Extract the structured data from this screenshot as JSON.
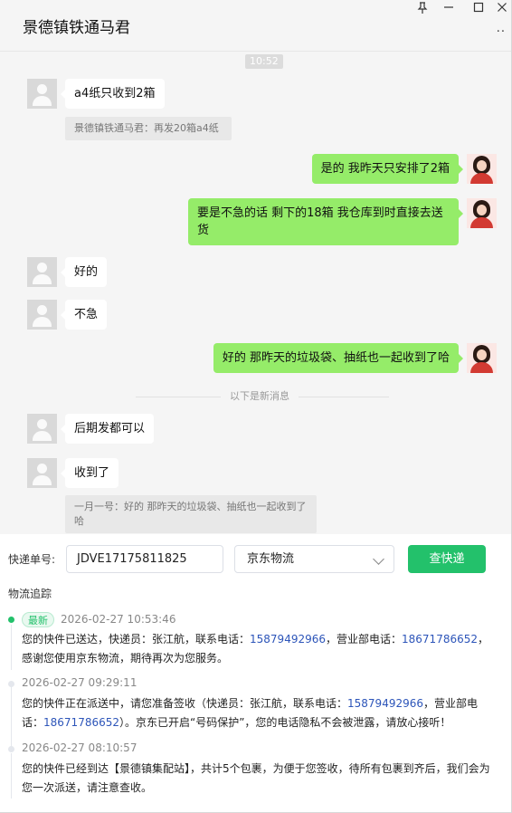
{
  "window": {
    "title": "景德镇铁通马君",
    "pin_icon": "pin-icon",
    "minimize_icon": "minimize-icon",
    "maximize_icon": "maximize-icon",
    "close_icon": "close-icon",
    "more_icon": "more-icon"
  },
  "chat": {
    "timestamp": "10:52",
    "messages": [
      {
        "side": "left",
        "text": "a4纸只收到2箱"
      },
      {
        "side": "left-quote",
        "text": "景德镇铁通马君：再发20箱a4纸"
      },
      {
        "side": "right",
        "text": "是的  我昨天只安排了2箱"
      },
      {
        "side": "right",
        "text": "要是不急的话 剩下的18箱  我仓库到时直接去送货"
      },
      {
        "side": "left",
        "text": "好的"
      },
      {
        "side": "left",
        "text": "不急"
      },
      {
        "side": "right",
        "text": "好的  那昨天的垃圾袋、抽纸也一起收到了哈"
      },
      {
        "side": "left",
        "text": "后期发都可以"
      },
      {
        "side": "left",
        "text": "收到了"
      },
      {
        "side": "left-quote",
        "text": "一月一号：好的  那昨天的垃圾袋、抽纸也一起收到了哈"
      }
    ],
    "new_messages_divider": "以下是新消息"
  },
  "tracking": {
    "number_label": "快递单号:",
    "number_value": "JDVE17175811825",
    "carrier_selected": "京东物流",
    "query_button": "查快递",
    "section_title": "物流追踪",
    "latest_tag": "最新",
    "events": [
      {
        "time": "2026-02-27 10:53:46",
        "parts": [
          "您的快件已送达，快递员：张江航，联系电话：",
          "15879492966",
          "，营业部电话：",
          "18671786652",
          "，感谢您使用京东物流，期待再次为您服务。"
        ]
      },
      {
        "time": "2026-02-27 09:29:11",
        "parts": [
          "您的快件正在派送中，请您准备签收（快递员：张江航，联系电话：",
          "15879492966",
          "，营业部电话：",
          "18671786652",
          "）。京东已开启“号码保护”，您的电话隐私不会被泄露，请放心接听！"
        ]
      },
      {
        "time": "2026-02-27 08:10:57",
        "parts": [
          "您的快件已经到达【景德镇集配站】，共计5个包裹，为便于您签收，待所有包裹到齐后，我们会为您一次派送，请注意查收。"
        ]
      }
    ]
  },
  "colors": {
    "accent_green": "#23c16b",
    "bubble_green": "#95ec69",
    "phone_blue": "#2d55b9"
  }
}
